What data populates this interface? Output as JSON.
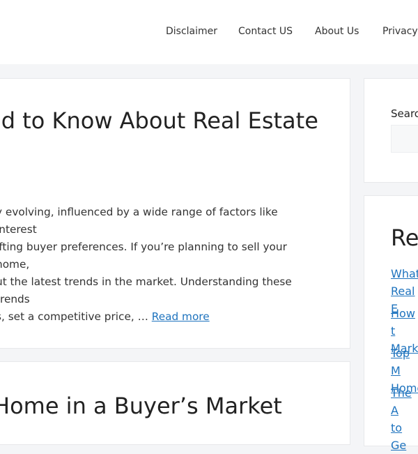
{
  "nav": {
    "items": [
      "Disclaimer",
      "Contact US",
      "About Us",
      "Privacy P"
    ]
  },
  "posts": [
    {
      "title": "ed to Know About Real Estate",
      "excerpt": "y evolving, influenced by a wide range of factors like interest\nifting buyer preferences. If you’re planning to sell your home,\nut the latest trends in the market. Understanding these trends\ns, set a competitive price, … ",
      "read_more": "Read more"
    },
    {
      "title": "Home in a Buyer’s Market"
    }
  ],
  "sidebar": {
    "search_label": "Searc",
    "recent_heading": "Re",
    "recent_links": [
      "What\nReal E",
      "How t\nMarke",
      "Top M\nHome",
      "The A\nto Ge"
    ]
  }
}
